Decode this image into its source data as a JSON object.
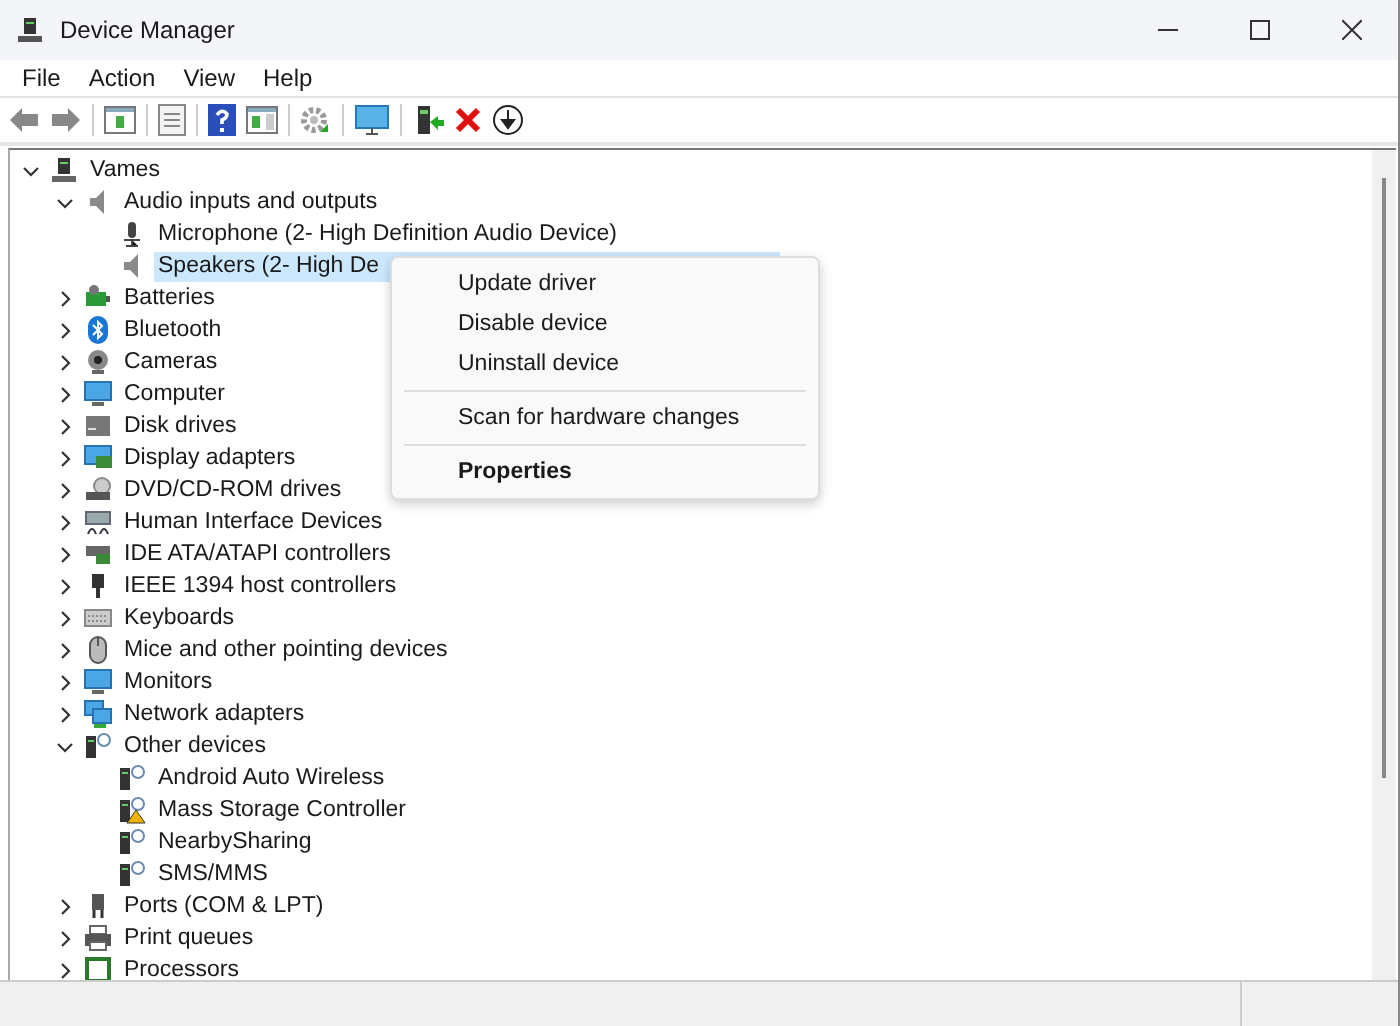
{
  "window": {
    "title": "Device Manager"
  },
  "menu": [
    "File",
    "Action",
    "View",
    "Help"
  ],
  "tree": {
    "label": "Vames",
    "expanded": true,
    "selected": false,
    "children": [
      {
        "label": "Audio inputs and outputs",
        "expanded": true,
        "selected": false,
        "children": [
          {
            "label": "Microphone (2- High Definition Audio Device)",
            "selected": false
          },
          {
            "label": "Speakers (2- High De",
            "selected": true
          }
        ]
      },
      {
        "label": "Batteries",
        "expanded": false,
        "selected": false
      },
      {
        "label": "Bluetooth",
        "expanded": false,
        "selected": false
      },
      {
        "label": "Cameras",
        "expanded": false,
        "selected": false
      },
      {
        "label": "Computer",
        "expanded": false,
        "selected": false
      },
      {
        "label": "Disk drives",
        "expanded": false,
        "selected": false
      },
      {
        "label": "Display adapters",
        "expanded": false,
        "selected": false
      },
      {
        "label": "DVD/CD-ROM drives",
        "expanded": false,
        "selected": false
      },
      {
        "label": "Human Interface Devices",
        "expanded": false,
        "selected": false
      },
      {
        "label": "IDE ATA/ATAPI controllers",
        "expanded": false,
        "selected": false
      },
      {
        "label": "IEEE 1394 host controllers",
        "expanded": false,
        "selected": false
      },
      {
        "label": "Keyboards",
        "expanded": false,
        "selected": false
      },
      {
        "label": "Mice and other pointing devices",
        "expanded": false,
        "selected": false
      },
      {
        "label": "Monitors",
        "expanded": false,
        "selected": false
      },
      {
        "label": "Network adapters",
        "expanded": false,
        "selected": false
      },
      {
        "label": "Other devices",
        "expanded": true,
        "selected": false,
        "children": [
          {
            "label": "Android Auto Wireless",
            "selected": false
          },
          {
            "label": "Mass Storage Controller",
            "selected": false
          },
          {
            "label": "NearbySharing",
            "selected": false
          },
          {
            "label": "SMS/MMS",
            "selected": false
          }
        ]
      },
      {
        "label": "Ports (COM & LPT)",
        "expanded": false,
        "selected": false
      },
      {
        "label": "Print queues",
        "expanded": false,
        "selected": false
      },
      {
        "label": "Processors",
        "expanded": false,
        "selected": false
      }
    ]
  },
  "context_menu": [
    {
      "kind": "item",
      "label": "Update driver"
    },
    {
      "kind": "item",
      "label": "Disable device"
    },
    {
      "kind": "item",
      "label": "Uninstall device"
    },
    {
      "kind": "separator"
    },
    {
      "kind": "item",
      "label": "Scan for hardware changes"
    },
    {
      "kind": "separator"
    },
    {
      "kind": "default",
      "label": "Properties"
    }
  ]
}
